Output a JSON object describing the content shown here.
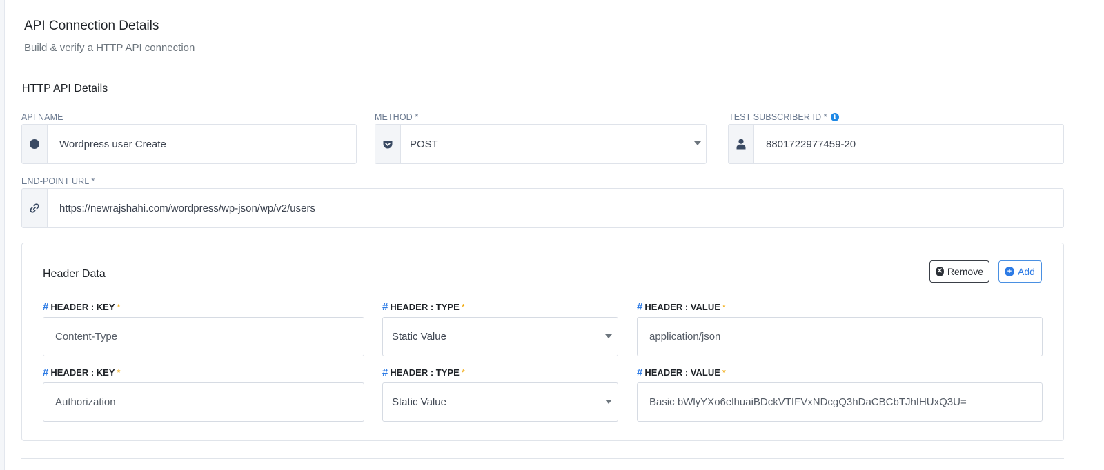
{
  "page": {
    "title": "API Connection Details",
    "subtitle": "Build & verify a HTTP API connection"
  },
  "section": {
    "title": "HTTP API Details"
  },
  "fields": {
    "api_name": {
      "label": "API NAME",
      "value": "Wordpress user Create",
      "icon": "circle-icon"
    },
    "method": {
      "label": "METHOD *",
      "value": "POST",
      "icon": "pocket-icon"
    },
    "test_subscriber": {
      "label": "TEST SUBSCRIBER ID *",
      "value": "8801722977459-20",
      "icon": "user-icon"
    },
    "endpoint": {
      "label": "END-POINT URL *",
      "value": "https://newrajshahi.com/wordpress/wp-json/wp/v2/users",
      "icon": "link-icon"
    }
  },
  "header_data": {
    "title": "Header Data",
    "remove_label": "Remove",
    "add_label": "Add",
    "key_label": "HEADER : KEY",
    "type_label": "HEADER : TYPE",
    "value_label": "HEADER : VALUE",
    "hash": "#",
    "required": "*",
    "rows": [
      {
        "key": "Content-Type",
        "type": "Static Value",
        "value": "application/json"
      },
      {
        "key": "Authorization",
        "type": "Static Value",
        "value": "Basic bWlyYXo6elhuaiBDckVTIFVxNDcgQ3hDaCBCbTJhIHUxQ3U="
      }
    ]
  },
  "colors": {
    "accent": "#2d7be5",
    "required": "#f0a500",
    "label": "#6b7a90",
    "info": "#1e88e5"
  }
}
